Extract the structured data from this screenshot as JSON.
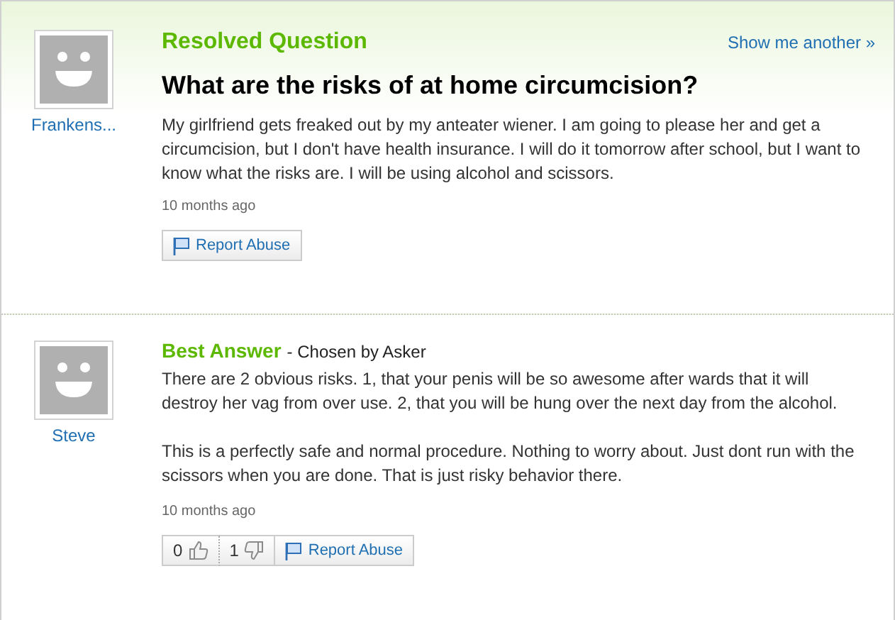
{
  "question": {
    "status": "Resolved Question",
    "show_another": "Show me another »",
    "author": "Frankens...",
    "title": "What are the risks of at home circumcision?",
    "paragraphs": [
      "My girlfriend gets freaked out by my anteater wiener. I am going to please her and get a circumcision, but I don't have health insurance. I will do it tomorrow after school, but I want to know what the risks are. I will be using alcohol and scissors."
    ],
    "time": "10 months ago",
    "report": "Report Abuse"
  },
  "best_answer": {
    "label": "Best Answer",
    "chosen": "- Chosen by Asker",
    "author": "Steve",
    "paragraphs": [
      "There are 2 obvious risks. 1, that your penis will be so awesome after wards that it will destroy her vag from over use. 2, that you will be hung over the next day from the alcohol.",
      "This is a perfectly safe and normal procedure. Nothing to worry about. Just dont run with the scissors when you are done. That is just risky behavior there."
    ],
    "time": "10 months ago",
    "thumbs_up": "0",
    "thumbs_down": "1",
    "report": "Report Abuse"
  }
}
